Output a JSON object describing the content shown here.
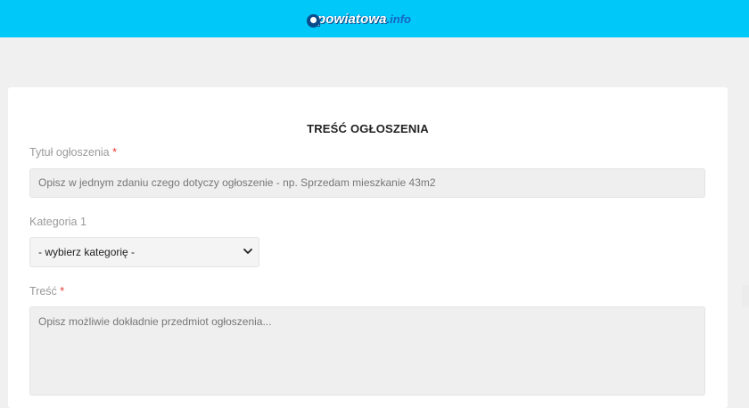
{
  "header": {
    "logo_main": "powiatowa",
    "logo_ext": ".info",
    "colors": {
      "bar": "#00c8f8",
      "brand_dark": "#0a4b8a",
      "accent_blue": "#1565c0"
    }
  },
  "form": {
    "section_title": "TREŚĆ OGŁOSZENIA",
    "title_field": {
      "label": "Tytuł ogłoszenia",
      "required_mark": "*",
      "placeholder": "Opisz w jednym zdaniu czego dotyczy ogłoszenie - np. Sprzedam mieszkanie 43m2"
    },
    "category_field": {
      "label": "Kategoria 1",
      "selected": "- wybierz kategorię -",
      "icon": "chevron-down-icon"
    },
    "content_field": {
      "label": "Treść",
      "required_mark": "*",
      "placeholder": "Opisz możliwie dokładnie przedmiot ogłoszenia..."
    },
    "required_color": "#e53935"
  }
}
